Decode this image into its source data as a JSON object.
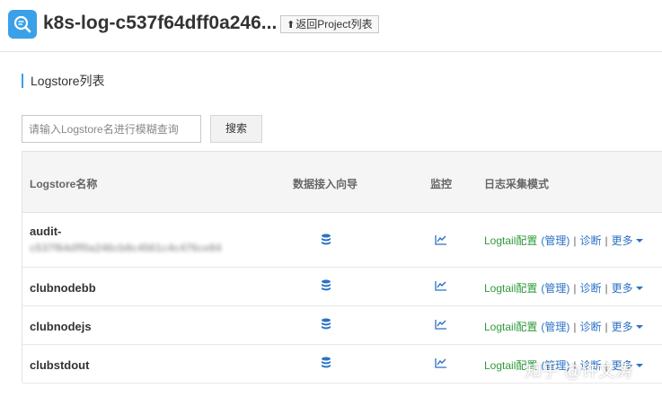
{
  "header": {
    "project_name": "k8s-log-c537f64dff0a246...",
    "back_label": "返回Project列表",
    "back_arrow": "⬆"
  },
  "section": {
    "title": "Logstore列表"
  },
  "search": {
    "placeholder": "请输入Logstore名进行模糊查询",
    "value": "",
    "button_label": "搜索"
  },
  "table": {
    "columns": {
      "name": "Logstore名称",
      "guide": "数据接入向导",
      "monitor": "监控",
      "mode": "日志采集模式"
    },
    "rows": [
      {
        "name": "audit-",
        "name_cont": "c537f64dff0a246cb8c4561c4c476ce84"
      },
      {
        "name": "clubnodebb"
      },
      {
        "name": "clubnodejs"
      },
      {
        "name": "clubstdout"
      }
    ],
    "actions": {
      "config": "Logtail配置",
      "manage": "(管理)",
      "separator": "|",
      "diagnose": "诊断",
      "more": "更多"
    }
  },
  "watermark": "知乎 @许文涛",
  "colors": {
    "accent": "#3aa0e8",
    "link": "#2b72c4",
    "config_green": "#2d9a3a"
  }
}
